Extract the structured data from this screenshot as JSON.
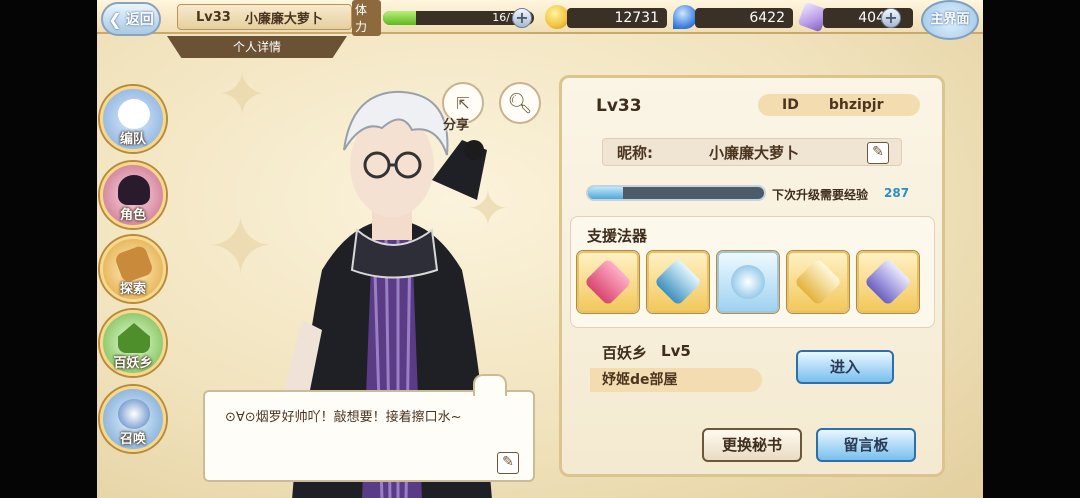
{
  "header": {
    "back_label": "返回",
    "level": "Lv33",
    "player_name": "小廉廉大萝卜",
    "stamina_label": "体力",
    "stamina_value": "16/72",
    "stamina_fraction": 0.22,
    "gold": "12731",
    "water": "6422",
    "crystal": "404",
    "main_label": "主界面",
    "subtitle": "个人详情"
  },
  "nav": {
    "items": [
      {
        "label": "编队",
        "icon": "team-icon"
      },
      {
        "label": "角色",
        "icon": "character-icon"
      },
      {
        "label": "探索",
        "icon": "explore-icon"
      },
      {
        "label": "百妖乡",
        "icon": "village-icon"
      },
      {
        "label": "召唤",
        "icon": "summon-icon"
      }
    ]
  },
  "actions": {
    "share_label": "分享"
  },
  "dialog": {
    "text": "⊙∀⊙烟罗好帅吖！敲想要！接着擦口水~"
  },
  "profile": {
    "level": "Lv33",
    "id_label": "ID",
    "id_value": "bhzipjr",
    "nickname_label": "昵称:",
    "nickname_value": "小廉廉大萝卜",
    "exp_label": "下次升级需要经验",
    "exp_value": "287",
    "exp_fraction": 0.2,
    "support_title": "支援法器",
    "home_label": "百妖乡",
    "home_level": "Lv5",
    "room_name": "妤姬de部屋",
    "enter_label": "进入",
    "change_secretary_label": "更换秘书",
    "message_board_label": "留言板"
  },
  "colors": {
    "gold": "#f2c43c",
    "water": "#3a7fe0",
    "crystal": "#b79ae6",
    "accent_blue": "#78bfee"
  }
}
